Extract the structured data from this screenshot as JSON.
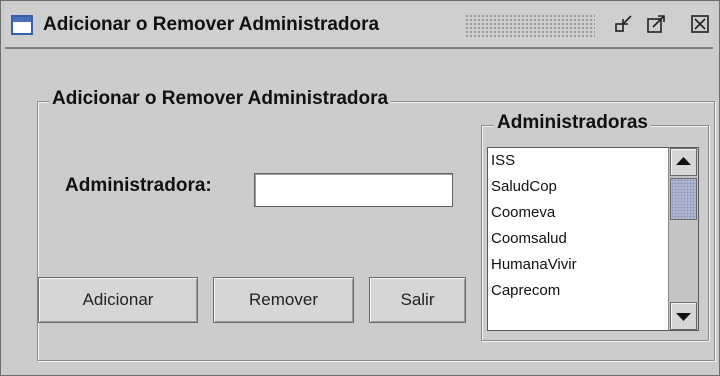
{
  "window": {
    "title": "Adicionar o Remover Administradora",
    "controls": [
      "restore-icon",
      "maximize-icon",
      "close-icon"
    ]
  },
  "form": {
    "group_title": "Adicionar o Remover Administradora",
    "field_label": "Administradora:",
    "field_value": "",
    "buttons": {
      "add": "Adicionar",
      "remove": "Remover",
      "exit": "Salir"
    }
  },
  "list": {
    "group_title": "Administradoras",
    "items": [
      "ISS",
      "SaludCop",
      "Coomeva",
      "Coomsalud",
      "HumanaVivir",
      "Caprecom"
    ]
  },
  "colors": {
    "window_bg": "#cccccc",
    "scroll_thumb": "#b8bfd8",
    "icon_blue": "#3b5ea8"
  }
}
